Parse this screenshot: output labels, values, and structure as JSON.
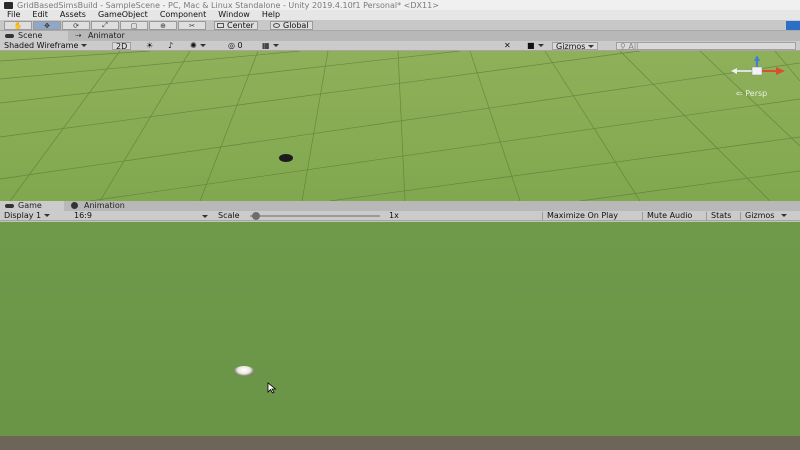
{
  "window": {
    "title": "GridBasedSimsBuild - SampleScene - PC, Mac & Linux Standalone - Unity 2019.4.10f1 Personal* <DX11>"
  },
  "menu": [
    "File",
    "Edit",
    "Assets",
    "GameObject",
    "Component",
    "Window",
    "Help"
  ],
  "toolbar": {
    "pivot_mode": "Center",
    "pivot_rotation": "Global",
    "tools": [
      "hand-tool",
      "move-tool",
      "rotate-tool",
      "scale-tool",
      "rect-tool",
      "transform-tool",
      "custom-tool"
    ]
  },
  "scene_panel": {
    "tabs": [
      "Scene",
      "Animator"
    ],
    "draw_mode": "Shaded Wireframe",
    "mode_2d": "2D",
    "hidden_count": "0",
    "gizmos_label": "Gizmos",
    "search_placeholder": "All",
    "projection_label": "Persp"
  },
  "game_panel": {
    "tabs": [
      "Game",
      "Animation"
    ],
    "display": "Display 1",
    "aspect": "16:9",
    "scale_label": "Scale",
    "scale_value": "1x",
    "scale_level": 0.02,
    "buttons": [
      "Maximize On Play",
      "Mute Audio",
      "Stats",
      "Gizmos"
    ]
  },
  "colors": {
    "scene_ground": "#86ac54",
    "game_ground": "#6e9848",
    "play_button": "#2d6fc7",
    "gizmo_x": "#d9502f",
    "gizmo_y": "#7ac043",
    "gizmo_z": "#3f7fd8"
  }
}
